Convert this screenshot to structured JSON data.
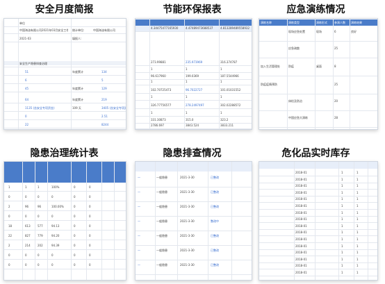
{
  "panels": [
    {
      "title": "安全月度简报",
      "rows": [
        {
          "a": "单位",
          "b": ""
        },
        {
          "a": "中国海油有限公司2021年03月安全工作简报",
          "b": "统计单位:",
          "c": "中国海油有限公司"
        },
        {
          "a": "2021-03",
          "b": "填报人:"
        },
        {
          "a": "安全生产隐患排查治理",
          "b": ""
        },
        {
          "a": "51",
          "b": "年度累计",
          "c": "134"
        },
        {
          "a": "6",
          "b": "",
          "c": "5"
        },
        {
          "a": "45",
          "b": "年度累计",
          "c": "129"
        },
        {
          "a": "64",
          "b": "年度累计",
          "c": "219"
        },
        {
          "a": "1135 (含安全专项资金)",
          "b": "109 天",
          "c": "3405 (含安全专项资金)"
        },
        {
          "a": "0",
          "b": "",
          "c": "2.51"
        },
        {
          "a": "22",
          "b": "",
          "c": "8244"
        }
      ]
    },
    {
      "title": "节能环保报表",
      "header": [
        "",
        "",
        "",
        ""
      ],
      "values": [
        "4.34475477165930",
        "4.47489473688537",
        "4.813289489558932",
        "273.99881",
        "235.973969",
        "316.374787",
        "1",
        "1",
        "1",
        "96.617960",
        "199.0369",
        "187.5544966",
        "1",
        "1",
        "1",
        "102.70725473",
        "96.7022727",
        "101.01031552",
        "1",
        "1",
        "1",
        "326.77756577",
        "278.2497497",
        "302.02288572",
        "1",
        "1",
        "1",
        "331.30873",
        "315.0",
        "323.2",
        "2786.697",
        "3843.524",
        "3833.211"
      ]
    },
    {
      "title": "应急演练情况",
      "header": [
        "演练名称",
        "演练类型",
        "演练形式",
        "参演人数",
        "演练结果"
      ],
      "rows": [
        [
          "",
          "现场应急处置",
          "现场",
          "6",
          "良好"
        ],
        [
          "",
          "应急疏散",
          "",
          "25",
          ""
        ],
        [
          "加入生活管理处",
          "防疫",
          "桌面",
          "8",
          ""
        ],
        [
          "防疫疫情预防",
          "",
          "",
          "25",
          ""
        ],
        [
          "",
          "体检及防治",
          "",
          "20",
          ""
        ],
        [
          "",
          "中国应急大演练",
          "",
          "28",
          ""
        ]
      ]
    },
    {
      "title": "隐患治理统计表",
      "rows": [
        [
          "1",
          "1",
          "1",
          "100%",
          "0",
          "0"
        ],
        [
          "0",
          "0",
          "0",
          "0",
          "0",
          "0"
        ],
        [
          "2",
          "96",
          "96",
          "100.00%",
          "0",
          "0"
        ],
        [
          "0",
          "0",
          "0",
          "0",
          "0",
          "0"
        ],
        [
          "18",
          "613",
          "577",
          "94.13",
          "0",
          "0"
        ],
        [
          "22",
          "827",
          "779",
          "94.20",
          "0",
          "0"
        ],
        [
          "2",
          "214",
          "202",
          "94.39",
          "0",
          "0"
        ],
        [
          "0",
          "0",
          "0",
          "0",
          "0",
          "0"
        ],
        [
          "0",
          "0",
          "0",
          "0",
          "0",
          "0"
        ]
      ]
    },
    {
      "title": "隐患排查情况",
      "rows": [
        [
          "一般隐患",
          "2021-3-30",
          "已整改"
        ],
        [
          "一般隐患",
          "2021-3-30",
          "已整改"
        ],
        [
          "一般隐患",
          "2021-3-30",
          "已整改"
        ],
        [
          "一般隐患",
          "2021-3-30",
          "整改中"
        ],
        [
          "一般隐患",
          "2021-3-30",
          "已整改"
        ],
        [
          "一般隐患",
          "2021-3-30",
          "已整改"
        ],
        [
          "一般隐患",
          "2021-3-30",
          "已整改"
        ]
      ]
    },
    {
      "title": "危化品实时库存",
      "rows": [
        [
          "",
          "2018-01",
          "1",
          "1"
        ],
        [
          "",
          "2018-01",
          "1",
          "1"
        ],
        [
          "",
          "2018-01",
          "1",
          "1"
        ],
        [
          "",
          "2018-01",
          "1",
          "1"
        ],
        [
          "",
          "2018-01",
          "1",
          "1"
        ],
        [
          "",
          "2018-01",
          "1",
          "1"
        ],
        [
          "",
          "2018-01",
          "1",
          "1"
        ],
        [
          "",
          "2018-01",
          "1",
          "1"
        ],
        [
          "",
          "2018-01",
          "1",
          "1"
        ],
        [
          "",
          "2018-01",
          "1",
          "1"
        ],
        [
          "",
          "2018-01",
          "1",
          "1"
        ],
        [
          "",
          "2018-01",
          "1",
          "1"
        ],
        [
          "",
          "2018-01",
          "1",
          "1"
        ],
        [
          "",
          "2018-01",
          "1",
          "1"
        ],
        [
          "",
          "2018-01",
          "1",
          "1"
        ],
        [
          "",
          "2018-01",
          "1",
          "1"
        ]
      ]
    }
  ]
}
